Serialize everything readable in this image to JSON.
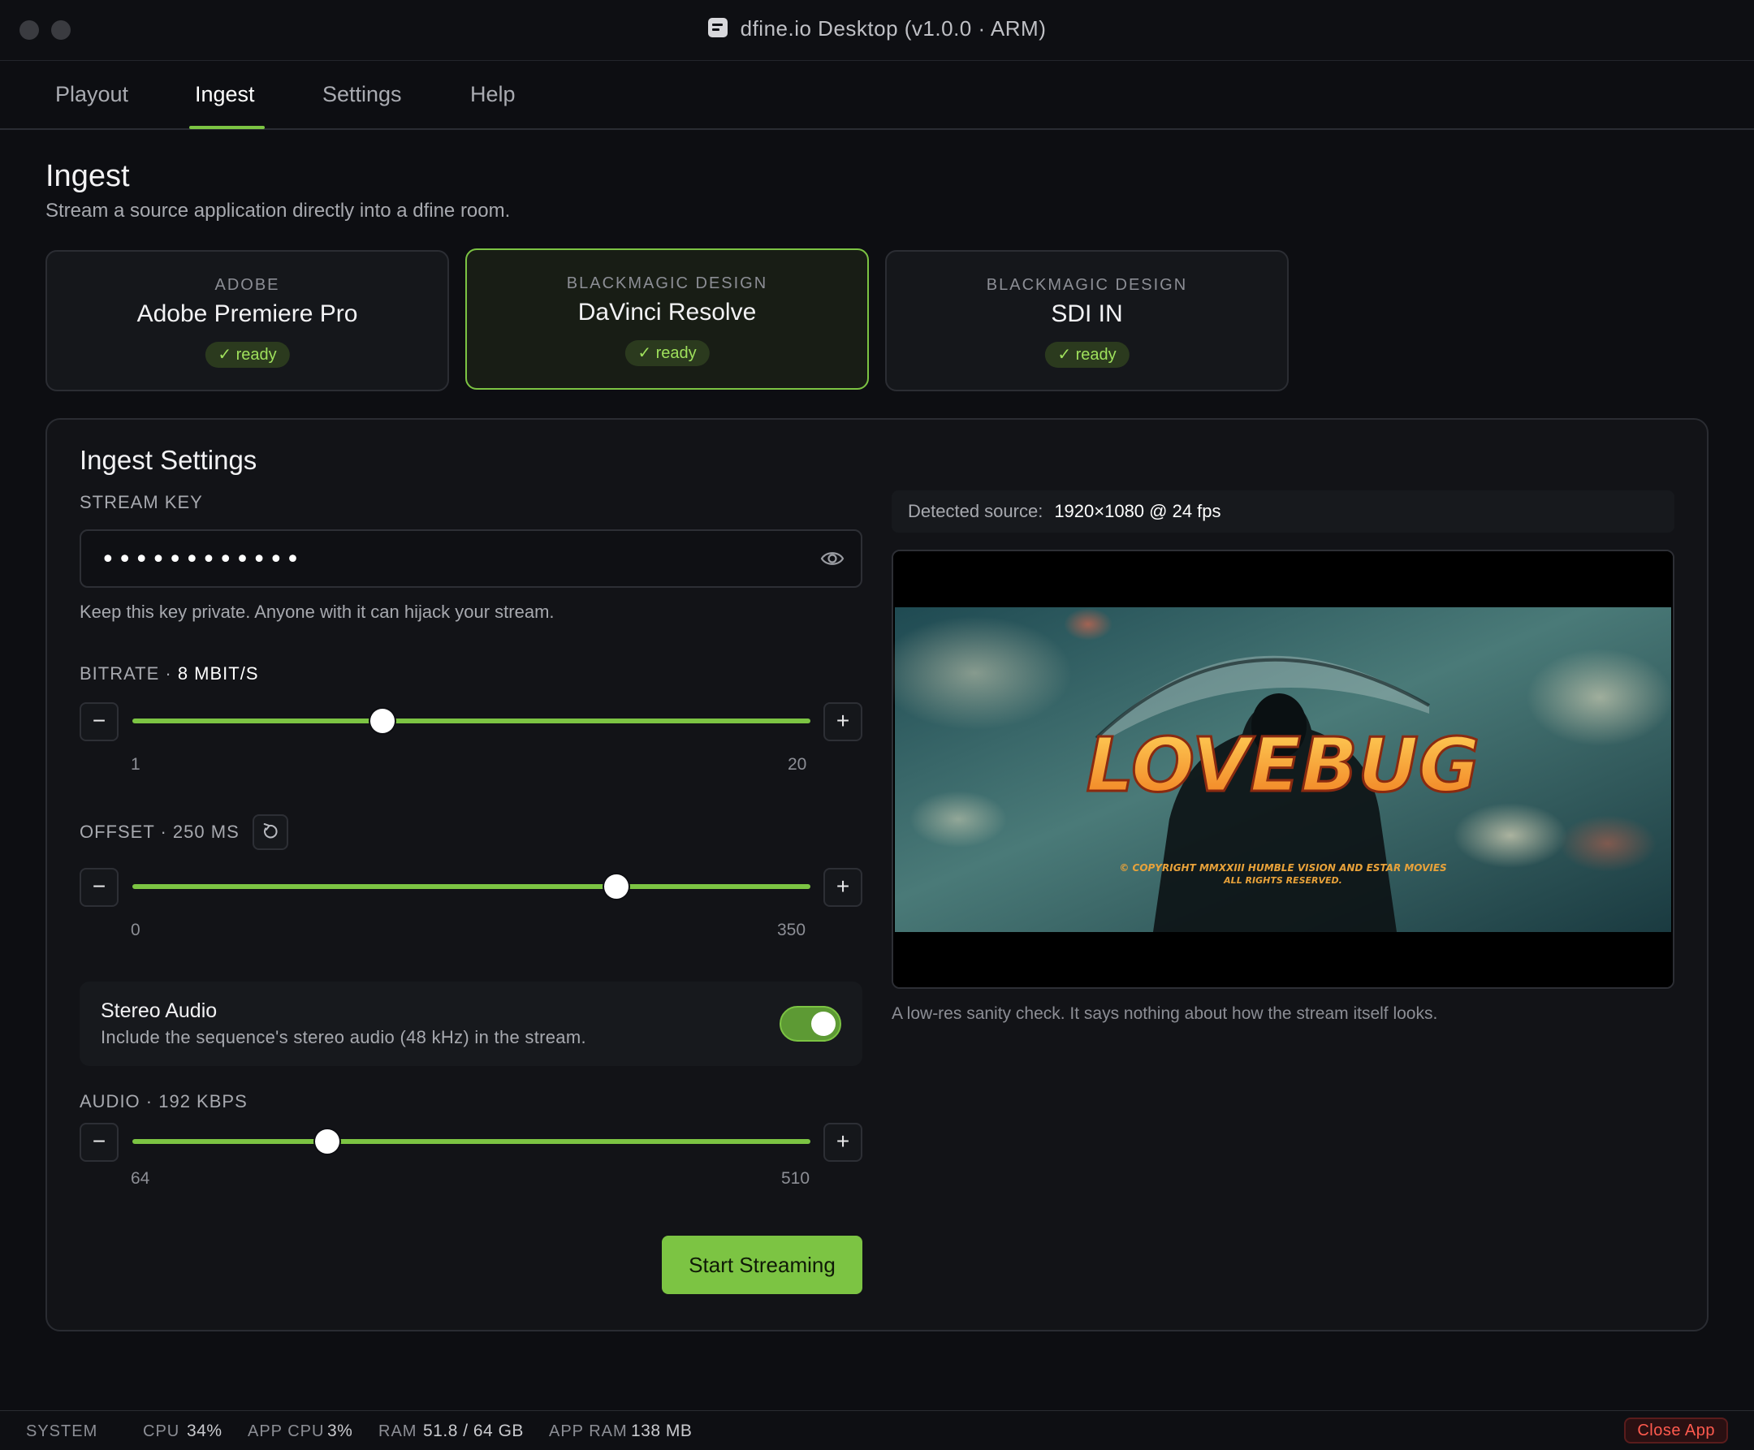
{
  "window": {
    "title": "dfine.io Desktop (v1.0.0 · ARM)"
  },
  "tabs": [
    {
      "label": "Playout"
    },
    {
      "label": "Ingest",
      "active": true
    },
    {
      "label": "Settings"
    },
    {
      "label": "Help"
    }
  ],
  "header": {
    "title": "Ingest",
    "subtitle": "Stream a source application directly into a dfine room."
  },
  "sources": [
    {
      "vendor": "ADOBE",
      "name": "Adobe Premiere Pro",
      "status": "✓ ready",
      "selected": false
    },
    {
      "vendor": "BLACKMAGIC DESIGN",
      "name": "DaVinci Resolve",
      "status": "✓ ready",
      "selected": true
    },
    {
      "vendor": "BLACKMAGIC DESIGN",
      "name": "SDI IN",
      "status": "✓ ready",
      "selected": false
    }
  ],
  "settings": {
    "title": "Ingest Settings",
    "stream_key": {
      "label": "STREAM KEY",
      "value": "••••••••••••",
      "help": "Keep this key private. Anyone with it can hijack your stream."
    },
    "bitrate": {
      "label": "BITRATE · ",
      "value_label": "8 MBIT/S",
      "min": 1,
      "max": 20,
      "value": 8,
      "min_label": "1",
      "max_label": "20"
    },
    "offset": {
      "label": "OFFSET · 250 MS",
      "min": 0,
      "max": 350,
      "value": 250,
      "min_label": "0",
      "max_label": "350"
    },
    "stereo_audio": {
      "title": "Stereo Audio",
      "description": "Include the sequence's stereo audio (48 kHz) in the stream.",
      "enabled": true
    },
    "audio": {
      "label": "AUDIO · 192 KBPS",
      "min": 64,
      "max": 510,
      "value": 192,
      "min_label": "64",
      "max_label": "510"
    },
    "start_button": "Start Streaming"
  },
  "preview": {
    "detected_label": "Detected source:",
    "detected_value": "1920×1080 @ 24 fps",
    "poster_title": "LOVEBUG",
    "poster_credit_1": "© COPYRIGHT MMXXIII HUMBLE VISION AND ESTAR MOVIES",
    "poster_credit_2": "ALL RIGHTS RESERVED.",
    "note": "A low-res sanity check. It says nothing about how the stream itself looks."
  },
  "statusbar": {
    "system_label": "SYSTEM",
    "cpu_label": "CPU",
    "cpu_value": "34%",
    "app_cpu_label": "APP CPU",
    "app_cpu_value": "3%",
    "ram_label": "RAM",
    "ram_value": "51.8 / 64 GB",
    "app_ram_label": "APP RAM",
    "app_ram_value": "138 MB",
    "close_label": "Close App"
  },
  "icons": {
    "eye": "eye-icon",
    "reset": "reset-icon",
    "minus": "−",
    "plus": "+"
  },
  "colors": {
    "accent": "#7cc443",
    "background": "#0d0e12",
    "danger": "#ff5a4e"
  }
}
